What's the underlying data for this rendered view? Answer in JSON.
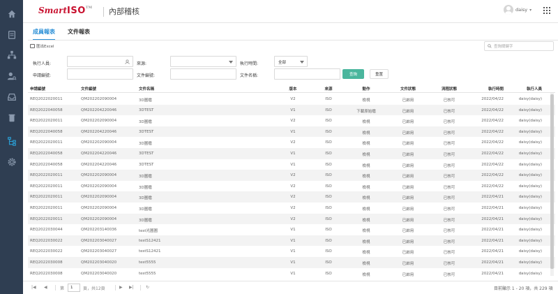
{
  "sidebar": {
    "items": [
      {
        "icon": "home-icon"
      },
      {
        "icon": "document-icon"
      },
      {
        "icon": "org-chart-icon"
      },
      {
        "icon": "user-search-icon"
      },
      {
        "icon": "inbox-icon"
      },
      {
        "icon": "trash-icon"
      },
      {
        "icon": "flow-icon"
      },
      {
        "icon": "gear-icon"
      }
    ],
    "active_index": 6,
    "bg_color": "#2f3e52",
    "active_color": "#2a9fd6"
  },
  "header": {
    "logo_smart": "Smart",
    "logo_iso": "ISO",
    "logo_tm": "TM",
    "app_title": "內部稽核",
    "user_name": "daisy"
  },
  "tabs": [
    {
      "label": "成員報表",
      "active": true
    },
    {
      "label": "文件報表",
      "active": false
    }
  ],
  "toolbar": {
    "export_label": "匯出Excel",
    "search_placeholder": "查詢關鍵字"
  },
  "filters": {
    "executor_label": "執行人員:",
    "source_label": "來源:",
    "exec_time_label": "執行時間:",
    "exec_time_value": "全部",
    "request_no_label": "申請編號:",
    "doc_no_label": "文件編號:",
    "doc_name_label": "文件名稱:",
    "query_button": "查詢",
    "reset_button": "重置"
  },
  "table": {
    "columns": [
      "申請編號",
      "文件編號",
      "文件名稱",
      "版本",
      "來源",
      "動作",
      "文件狀態",
      "流程狀態",
      "執行時間",
      "執行人員"
    ],
    "rows": [
      [
        "REQ2022020011",
        "QM202202090004",
        "3D圖檔",
        "V2",
        "ISO",
        "檢視",
        "已啟用",
        "已核可",
        "2022/04/22",
        "daisy(daisy)"
      ],
      [
        "REQ2022040058",
        "QM202204220046",
        "3DTEST",
        "V1",
        "ISO",
        "下載原始檔",
        "已啟用",
        "已核可",
        "2022/04/22",
        "daisy(daisy)"
      ],
      [
        "REQ2022020011",
        "QM202202090004",
        "3D圖檔",
        "V2",
        "ISO",
        "檢視",
        "已啟用",
        "已核可",
        "2022/04/22",
        "daisy(daisy)"
      ],
      [
        "REQ2022040058",
        "QM202204220046",
        "3DTEST",
        "V1",
        "ISO",
        "檢視",
        "已啟用",
        "已核可",
        "2022/04/22",
        "daisy(daisy)"
      ],
      [
        "REQ2022020011",
        "QM202202090004",
        "3D圖檔",
        "V2",
        "ISO",
        "檢視",
        "已啟用",
        "已核可",
        "2022/04/22",
        "daisy(daisy)"
      ],
      [
        "REQ2022040058",
        "QM202204220046",
        "3DTEST",
        "V1",
        "ISO",
        "檢視",
        "已啟用",
        "已核可",
        "2022/04/22",
        "daisy(daisy)"
      ],
      [
        "REQ2022040058",
        "QM202204220046",
        "3DTEST",
        "V1",
        "ISO",
        "檢視",
        "已啟用",
        "已核可",
        "2022/04/22",
        "daisy(daisy)"
      ],
      [
        "REQ2022020011",
        "QM202202090004",
        "3D圖檔",
        "V2",
        "ISO",
        "檢視",
        "已啟用",
        "已核可",
        "2022/04/22",
        "daisy(daisy)"
      ],
      [
        "REQ2022020011",
        "QM202202090004",
        "3D圖檔",
        "V2",
        "ISO",
        "檢視",
        "已啟用",
        "已核可",
        "2022/04/22",
        "daisy(daisy)"
      ],
      [
        "REQ2022020011",
        "QM202202090004",
        "3D圖檔",
        "V2",
        "ISO",
        "檢視",
        "已啟用",
        "已核可",
        "2022/04/21",
        "daisy(daisy)"
      ],
      [
        "REQ2022020011",
        "QM202202090004",
        "3D圖檔",
        "V2",
        "ISO",
        "檢視",
        "已啟用",
        "已核可",
        "2022/04/21",
        "daisy(daisy)"
      ],
      [
        "REQ2022020011",
        "QM202202090004",
        "3D圖檔",
        "V2",
        "ISO",
        "檢視",
        "已啟用",
        "已核可",
        "2022/04/21",
        "daisy(daisy)"
      ],
      [
        "REQ2022030044",
        "QM202203140036",
        "test光圖圖",
        "V1",
        "ISO",
        "檢視",
        "已啟用",
        "已核可",
        "2022/04/21",
        "daisy(daisy)"
      ],
      [
        "REQ2022030022",
        "QM202203040027",
        "testS12421",
        "V1",
        "ISO",
        "檢視",
        "已啟用",
        "已核可",
        "2022/04/21",
        "daisy(daisy)"
      ],
      [
        "REQ2022030022",
        "QM202203040027",
        "testS12421",
        "V1",
        "ISO",
        "檢視",
        "已啟用",
        "已核可",
        "2022/04/21",
        "daisy(daisy)"
      ],
      [
        "REQ2022030008",
        "QM202203040020",
        "test5555",
        "V1",
        "ISO",
        "檢視",
        "已啟用",
        "已核可",
        "2022/04/21",
        "daisy(daisy)"
      ],
      [
        "REQ2022030008",
        "QM202203040020",
        "test5555",
        "V1",
        "ISO",
        "檢視",
        "已啟用",
        "已核可",
        "2022/04/21",
        "daisy(daisy)"
      ]
    ]
  },
  "pager": {
    "page_prefix": "第",
    "page_value": "1",
    "page_suffix": "頁，共12頁",
    "summary": "目前顯示 1 - 20 項，共 229 項"
  }
}
